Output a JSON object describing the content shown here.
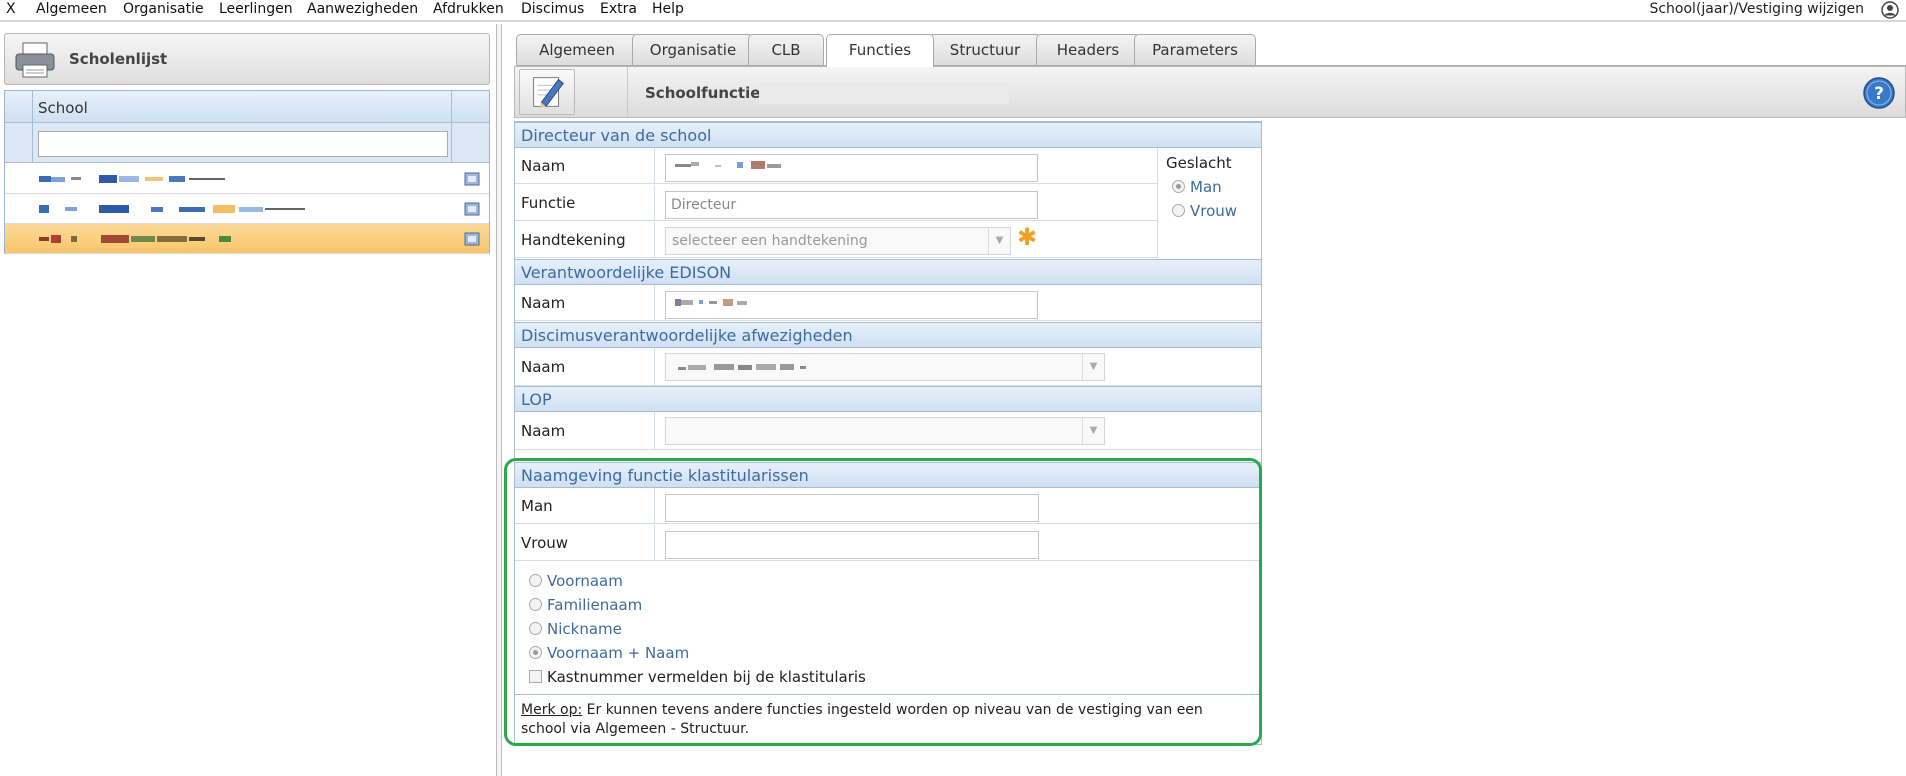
{
  "menu": {
    "items": [
      "X",
      "Algemeen",
      "Organisatie",
      "Leerlingen",
      "Aanwezigheden",
      "Afdrukken",
      "Discimus",
      "Extra",
      "Help"
    ],
    "right_link": "School(jaar)/Vestiging wijzigen"
  },
  "left": {
    "title": "Scholenlijst",
    "grid_header": "School",
    "filter_value": ""
  },
  "tabs": [
    "Algemeen",
    "Organisatie",
    "CLB",
    "Functies",
    "Structuur",
    "Headers",
    "Parameters"
  ],
  "active_tab": "Functies",
  "toolbar": {
    "label": "Schoolfuncties:"
  },
  "form": {
    "directeur": {
      "section": "Directeur van de school",
      "naam_label": "Naam",
      "functie_label": "Functie",
      "functie_value": "Directeur",
      "handtekening_label": "Handtekening",
      "handtekening_value": "selecteer een handtekening",
      "geslacht_label": "Geslacht",
      "man": "Man",
      "vrouw": "Vrouw"
    },
    "edison": {
      "section": "Verantwoordelijke EDISON",
      "naam_label": "Naam"
    },
    "discimus": {
      "section": "Discimusverantwoordelijke afwezigheden",
      "naam_label": "Naam"
    },
    "lop": {
      "section": "LOP",
      "naam_label": "Naam"
    },
    "klastitularis": {
      "section": "Naamgeving functie klastitularissen",
      "man_label": "Man",
      "vrouw_label": "Vrouw",
      "options": [
        "Voornaam",
        "Familienaam",
        "Nickname",
        "Voornaam + Naam"
      ],
      "selected_option": "Voornaam + Naam",
      "checkbox_label": "Kastnummer vermelden bij de klastitularis"
    },
    "note": {
      "prefix": "Merk op:",
      "text": " Er kunnen tevens andere functies ingesteld worden op niveau van de vestiging van een school via Algemeen - Structuur."
    }
  },
  "colors": {
    "accent_blue": "#3d6aa0",
    "selected_row": "#f8c66a",
    "highlight": "#2aa84a",
    "asterisk": "#f0a020"
  }
}
